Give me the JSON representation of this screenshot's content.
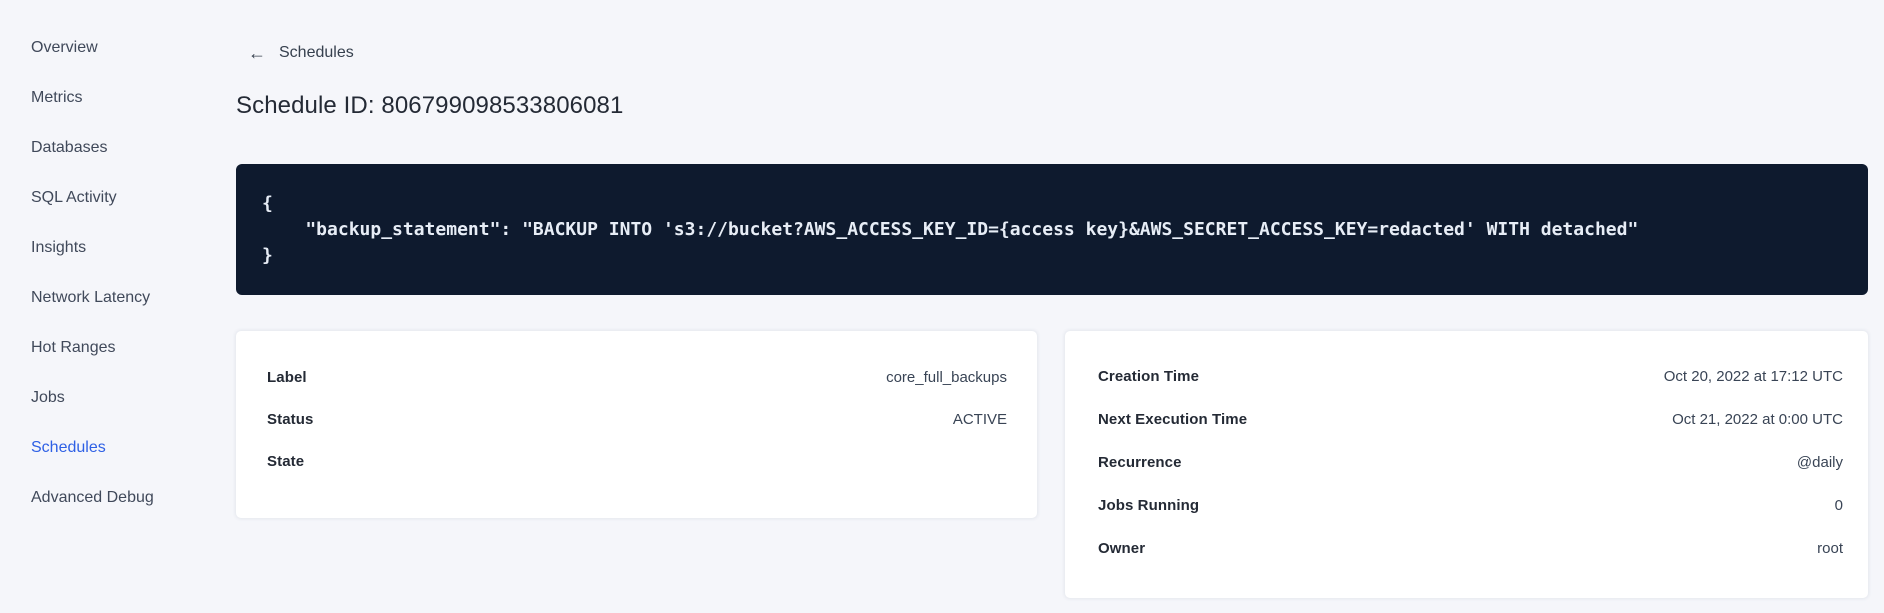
{
  "sidebar": {
    "items": [
      {
        "label": "Overview"
      },
      {
        "label": "Metrics"
      },
      {
        "label": "Databases"
      },
      {
        "label": "SQL Activity"
      },
      {
        "label": "Insights"
      },
      {
        "label": "Network Latency"
      },
      {
        "label": "Hot Ranges"
      },
      {
        "label": "Jobs"
      },
      {
        "label": "Schedules",
        "active": true
      },
      {
        "label": "Advanced Debug"
      }
    ]
  },
  "header": {
    "back_icon": "←",
    "back_label": "Schedules",
    "title": "Schedule ID: 806799098533806081"
  },
  "code_block": {
    "lines": [
      "{",
      "    \"backup_statement\": \"BACKUP INTO 's3://bucket?AWS_ACCESS_KEY_ID={access key}&AWS_SECRET_ACCESS_KEY=redacted' WITH detached\"",
      "}"
    ]
  },
  "details_card": {
    "rows": [
      {
        "label": "Label",
        "value": "core_full_backups"
      },
      {
        "label": "Status",
        "value": "ACTIVE"
      },
      {
        "label": "State",
        "value": ""
      }
    ]
  },
  "schedule_card": {
    "rows": [
      {
        "label": "Creation Time",
        "value": "Oct 20, 2022 at 17:12 UTC"
      },
      {
        "label": "Next Execution Time",
        "value": "Oct 21, 2022 at 0:00 UTC"
      },
      {
        "label": "Recurrence",
        "value": "@daily"
      },
      {
        "label": "Jobs Running",
        "value": "0"
      },
      {
        "label": "Owner",
        "value": "root"
      }
    ]
  },
  "colors": {
    "page_bg": "#f5f6fa",
    "card_bg": "#ffffff",
    "code_bg": "#0e1a2e",
    "code_text": "#e7edf6",
    "accent_blue": "#2e60e5",
    "text_dark": "#242a35",
    "text_value": "#394455"
  }
}
